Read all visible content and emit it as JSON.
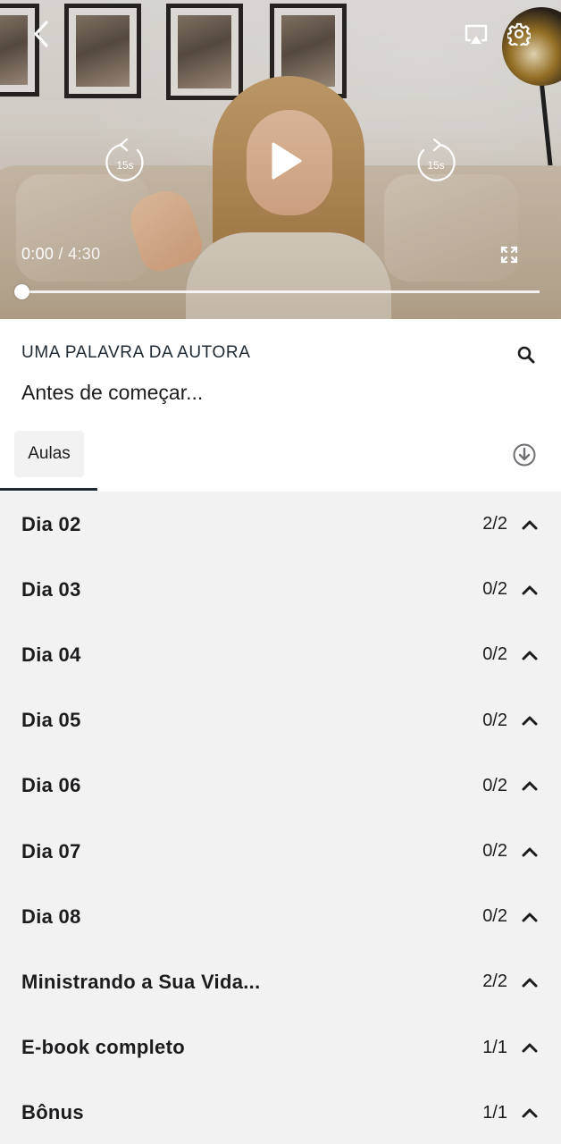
{
  "player": {
    "current_time": "0:00",
    "separator": " / ",
    "duration": "4:30",
    "rewind_label": "15s",
    "forward_label": "15s",
    "progress_fraction": 0.0,
    "icons": [
      "back-icon",
      "cast-icon",
      "gear-icon",
      "rewind-15s-icon",
      "play-icon",
      "forward-15s-icon",
      "fullscreen-icon"
    ]
  },
  "info": {
    "section_label": "UMA PALAVRA DA AUTORA",
    "lesson_title": "Antes de começar..."
  },
  "tabs": {
    "aulas_label": "Aulas"
  },
  "modules": [
    {
      "title": "Dia 02",
      "count": "2/2"
    },
    {
      "title": "Dia 03",
      "count": "0/2"
    },
    {
      "title": "Dia 04",
      "count": "0/2"
    },
    {
      "title": "Dia 05",
      "count": "0/2"
    },
    {
      "title": "Dia 06",
      "count": "0/2"
    },
    {
      "title": "Dia 07",
      "count": "0/2"
    },
    {
      "title": "Dia 08",
      "count": "0/2"
    },
    {
      "title": "Ministrando a Sua Vida...",
      "count": "2/2"
    },
    {
      "title": "E-book completo",
      "count": "1/1"
    },
    {
      "title": "Bônus",
      "count": "1/1"
    }
  ],
  "colors": {
    "list_background": "#f2f2f3",
    "accent_dark": "#1f2a33",
    "text": "#1c1c1e"
  }
}
